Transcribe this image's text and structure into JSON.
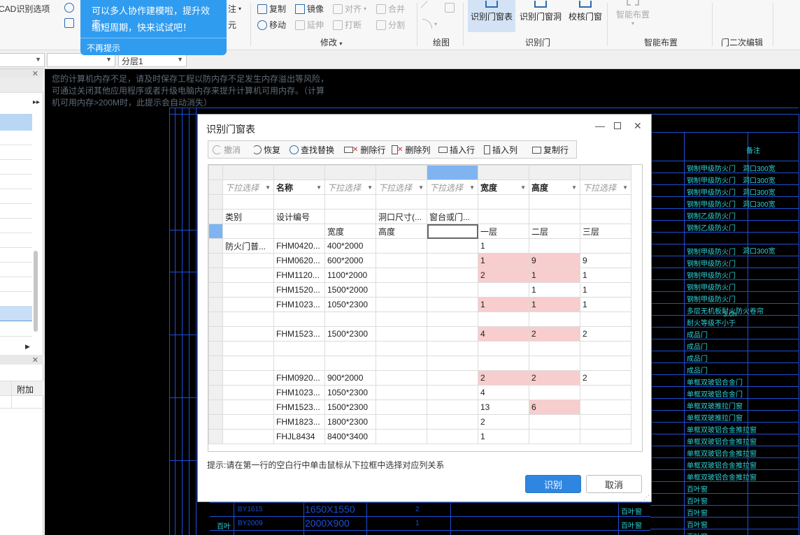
{
  "ribbon": {
    "cad_options": "CAD识别选项",
    "copy": "复制",
    "mirror": "镜像",
    "align": "对齐",
    "merge": "合并",
    "move": "移动",
    "extend": "延伸",
    "break": "打断",
    "split": "分割",
    "annotate": "注",
    "element": "元",
    "big_buttons": {
      "recognize_table": "识别门窗表",
      "recognize_opening": "识别门窗洞",
      "check_door": "校核门窗",
      "smart_layout": "智能布置"
    },
    "groups": {
      "modify": "修改",
      "draw": "绘图",
      "recognize_door": "识别门",
      "smart_layout": "智能布置",
      "door_secondary_edit": "门二次编辑"
    }
  },
  "toolbar2": {
    "floor_select": "分层1"
  },
  "tip": {
    "line1": "可以多人协作建模啦，提升效率，",
    "line2": "缩短周期，快来试试吧！",
    "dismiss": "不再提示"
  },
  "left_panel": {
    "extra_header": "附加"
  },
  "cad": {
    "memory_warning": "您的计算机内存不足，请及时保存工程以防内存不足发生内存溢出等风险，可通过关闭其他应用程序或者升级电脑内存来提升计算机可用内存。（计算机可用内存>200M时，此提示会自动消失）",
    "right_header": "备注",
    "right_rows": [
      "钢制甲级防火门",
      "钢制甲级防火门",
      "钢制甲级防火门",
      "钢制甲级防火门",
      "钢制乙级防火门",
      "钢制乙级防火门",
      "",
      "钢制甲级防火门",
      "钢制甲级防火门",
      "钢制甲级防火门",
      "钢制甲级防火门",
      "钢制甲级防火门",
      "多层无机板耐火防火卷帘",
      "耐火等级不小于",
      "成品门",
      "成品门",
      "成品门",
      "成品门",
      "单框双玻铝合金门",
      "单框双玻铝合金门",
      "单框双玻推拉门窗",
      "单框双玻推拉门窗",
      "单框双玻铝合金推拉窗",
      "单框双玻铝合金推拉窗",
      "单框双玻铝合金推拉窗",
      "单框双玻铝合金推拉窗",
      "单框双玻铝合金推拉窗",
      "百叶窗",
      "百叶窗",
      "百叶窗",
      "百叶窗",
      "百叶窗",
      "百叶窗"
    ],
    "right_notes": [
      "洞口300宽",
      "洞口300宽",
      "洞口300宽",
      "洞口300宽",
      "洞口300宽"
    ],
    "note_3h": "3.0h",
    "bottom_rows": [
      {
        "code": "BY1615",
        "size": "1650X1550",
        "qty": "2"
      },
      {
        "code": "BY2009",
        "size": "2000X900",
        "qty": "1"
      }
    ],
    "bottom_label": "百叶",
    "bottom_partial": "1650X1550"
  },
  "dialog": {
    "title": "识别门窗表",
    "toolbar": {
      "undo": "撤消",
      "redo": "恢复",
      "find_replace": "查找替换",
      "delete_row": "删除行",
      "delete_col": "删除列",
      "insert_row": "插入行",
      "insert_col": "插入列",
      "copy_row": "复制行"
    },
    "dropdown_row": [
      "下拉选择",
      "名称",
      "下拉选择",
      "下拉选择",
      "下拉选择",
      "宽度",
      "高度",
      "下拉选择"
    ],
    "rows": [
      [
        "",
        "",
        "",
        "",
        "",
        "",
        "",
        ""
      ],
      [
        "类别",
        "设计编号",
        "",
        "洞口尺寸(...",
        "窗台或门...",
        "",
        "",
        ""
      ],
      [
        "",
        "",
        "宽度",
        "高度",
        "",
        "一层",
        "二层",
        "三层"
      ],
      [
        "防火门普...",
        "FHM0420...",
        "400*2000",
        "",
        "",
        "1",
        "",
        ""
      ],
      [
        "",
        "FHM0620...",
        "600*2000",
        "",
        "",
        "1",
        "9",
        "9"
      ],
      [
        "",
        "FHM1120...",
        "1100*2000",
        "",
        "",
        "2",
        "1",
        "1"
      ],
      [
        "",
        "FHM1520...",
        "1500*2000",
        "",
        "",
        "",
        "1",
        "1"
      ],
      [
        "",
        "FHM1023...",
        "1050*2300",
        "",
        "",
        "1",
        "1",
        "1"
      ],
      [
        "",
        "",
        "",
        "",
        "",
        "",
        "",
        ""
      ],
      [
        "",
        "FHM1523...",
        "1500*2300",
        "",
        "",
        "4",
        "2",
        "2"
      ],
      [
        "",
        "",
        "",
        "",
        "",
        "",
        "",
        ""
      ],
      [
        "",
        "",
        "",
        "",
        "",
        "",
        "",
        ""
      ],
      [
        "",
        "FHM0920...",
        "900*2000",
        "",
        "",
        "2",
        "2",
        "2"
      ],
      [
        "",
        "FHM1023...",
        "1050*2300",
        "",
        "",
        "4",
        "",
        ""
      ],
      [
        "",
        "FHM1523...",
        "1500*2300",
        "",
        "",
        "13",
        "6",
        ""
      ],
      [
        "",
        "FHM1823...",
        "1800*2300",
        "",
        "",
        "2",
        "",
        ""
      ],
      [
        "",
        "FHJL8434",
        "8400*3400",
        "",
        "",
        "1",
        "",
        ""
      ]
    ],
    "hint": "提示:请在第一行的空白行中单击鼠标从下拉框中选择对应列关系",
    "ok": "识别",
    "cancel": "取消"
  }
}
